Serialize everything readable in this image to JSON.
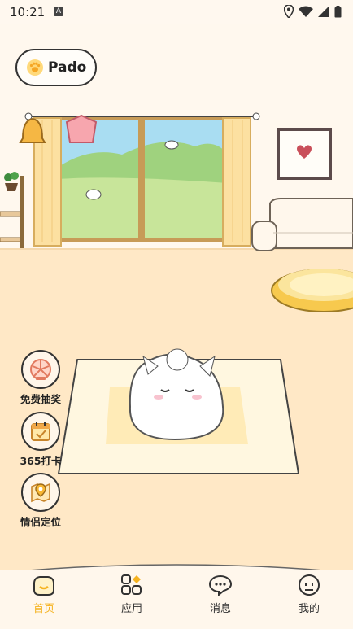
{
  "status_bar": {
    "time": "10:21",
    "notif_glyph": "A",
    "icons": [
      "location-icon",
      "wifi-icon",
      "signal-icon",
      "battery-icon"
    ]
  },
  "profile": {
    "name": "Pado",
    "icon": "paw-icon"
  },
  "side_actions": [
    {
      "label": "免费抽奖",
      "icon": "lottery-fan-icon"
    },
    {
      "label": "365打卡",
      "icon": "calendar-check-icon"
    },
    {
      "label": "情侣定位",
      "icon": "map-pin-icon"
    }
  ],
  "tabs": [
    {
      "label": "首页",
      "icon": "home-icon",
      "active": true
    },
    {
      "label": "应用",
      "icon": "apps-icon",
      "active": false
    },
    {
      "label": "消息",
      "icon": "message-icon",
      "active": false
    },
    {
      "label": "我的",
      "icon": "profile-icon",
      "active": false
    }
  ],
  "colors": {
    "accent": "#F5B21F",
    "floor": "#FFE8C6",
    "wall": "#FFF8EE",
    "text": "#222222"
  }
}
